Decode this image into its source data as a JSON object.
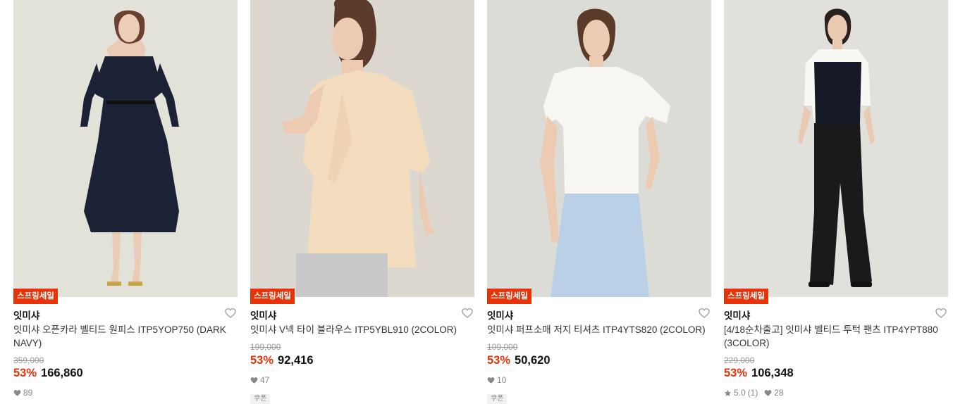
{
  "products": [
    {
      "badge": "스프링세일",
      "brand": "잇미샤",
      "name": "잇미샤 오픈카라 벨티드 원피스 ITP5YOP750 (DARK NAVY)",
      "original_price": "359,000",
      "discount": "53%",
      "price": "166,860",
      "likes": "89",
      "rating": "",
      "reviews": "",
      "coupon": ""
    },
    {
      "badge": "스프링세일",
      "brand": "잇미샤",
      "name": "잇미샤 V넥 타이 블라우스 ITP5YBL910 (2COLOR)",
      "original_price": "199,000",
      "discount": "53%",
      "price": "92,416",
      "likes": "47",
      "rating": "",
      "reviews": "",
      "coupon": "쿠폰"
    },
    {
      "badge": "스프링세일",
      "brand": "잇미샤",
      "name": "잇미샤 퍼프소매 저지 티셔츠 ITP4YTS820 (2COLOR)",
      "original_price": "109,000",
      "discount": "53%",
      "price": "50,620",
      "likes": "10",
      "rating": "",
      "reviews": "",
      "coupon": "쿠폰"
    },
    {
      "badge": "스프링세일",
      "brand": "잇미샤",
      "name": "[4/18순차출고] 잇미샤 벨티드 투턱 팬츠 ITP4YPT880 (3COLOR)",
      "original_price": "229,000",
      "discount": "53%",
      "price": "106,348",
      "likes": "28",
      "rating": "5.0",
      "reviews": "(1)",
      "coupon": ""
    }
  ],
  "colors": {
    "sale_badge": "#e8320a",
    "discount": "#e8320a"
  },
  "icons": {
    "like": "heart-outline-icon",
    "likes_count": "heart-filled-icon",
    "rating": "star-icon"
  }
}
